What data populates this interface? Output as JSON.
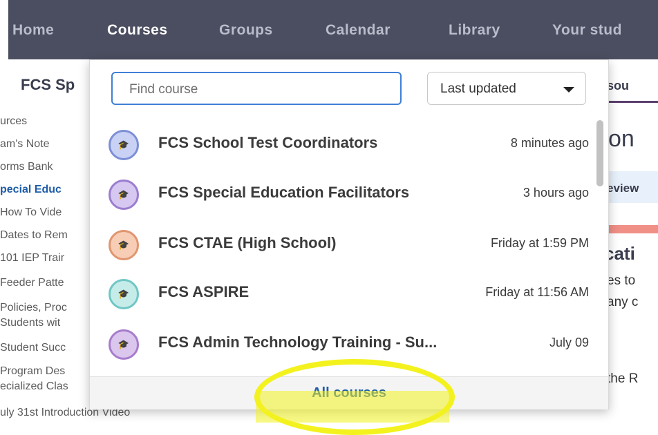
{
  "nav": {
    "items": [
      {
        "label": "Home",
        "active": false
      },
      {
        "label": "Courses",
        "active": true
      },
      {
        "label": "Groups",
        "active": false
      },
      {
        "label": "Calendar",
        "active": false
      },
      {
        "label": "Library",
        "active": false
      },
      {
        "label": "Your stud",
        "active": false
      }
    ]
  },
  "background": {
    "page_title": "FCS Sp",
    "right_tab": "esou",
    "right_heading": "on",
    "right_review": "eview",
    "right_section": "cati",
    "right_line1": "es to",
    "right_line2": "any c",
    "right_line3": "the R",
    "sidebar": [
      {
        "label": "urces",
        "active": false
      },
      {
        "label": "am's Note",
        "active": false
      },
      {
        "label": "orms Bank",
        "active": false
      },
      {
        "label": "pecial Educ",
        "active": true
      },
      {
        "label": "How To Vide",
        "active": false
      },
      {
        "label": "Dates to Rem",
        "active": false
      },
      {
        "label": "101 IEP Trair",
        "active": false
      },
      {
        "label": "Feeder Patte",
        "active": false
      },
      {
        "label": "Policies, Proc",
        "active": false
      },
      {
        "label": "Students wit",
        "active": false
      },
      {
        "label": "Student Succ",
        "active": false
      },
      {
        "label": "Program Des",
        "active": false
      },
      {
        "label": "ecialized Clas",
        "active": false
      },
      {
        "label": "uly 31st Introduction Video",
        "active": false
      }
    ]
  },
  "dropdown": {
    "search": {
      "placeholder": "Find course",
      "value": ""
    },
    "sort": {
      "selected": "Last updated"
    },
    "courses": [
      {
        "name": "FCS School Test Coordinators",
        "updated": "8 minutes ago",
        "color": "#7c8fd6",
        "fill": "#c9d2f4"
      },
      {
        "name": "FCS Special Education Facilitators",
        "updated": "3 hours ago",
        "color": "#9b7dd0",
        "fill": "#d6c8f0"
      },
      {
        "name": "FCS CTAE (High School)",
        "updated": "Friday at 1:59 PM",
        "color": "#e19570",
        "fill": "#f7cdb6"
      },
      {
        "name": "FCS ASPIRE",
        "updated": "Friday at 11:56 AM",
        "color": "#6fc7c5",
        "fill": "#c6ecea"
      },
      {
        "name": "FCS Admin Technology Training - Su...",
        "updated": "July 09",
        "color": "#a77ccc",
        "fill": "#dbc6ee"
      }
    ],
    "footer_link": "All courses"
  },
  "icons": {
    "course_avatar": "graduation-cap-icon",
    "sort_chevron": "chevron-down-icon"
  }
}
